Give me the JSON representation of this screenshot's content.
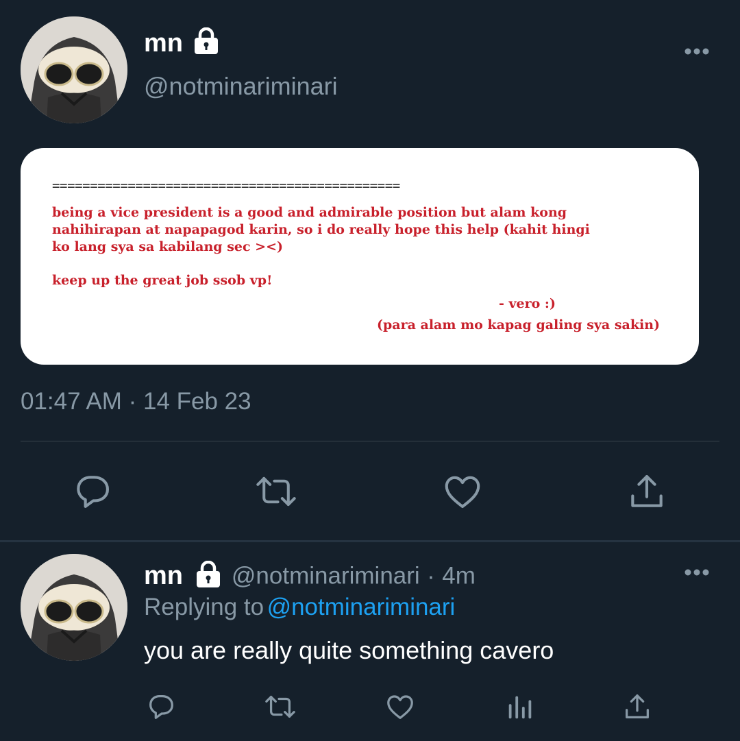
{
  "tweet": {
    "display_name": "mn",
    "handle": "@notminariminari",
    "card": {
      "separator": "==============================================",
      "paragraph1": "being a vice president is a good and admirable position but alam kong\nnahihirapan at napapagod karin, so i do really hope this help (kahit hingi\nko lang sya sa kabilang sec ><)",
      "paragraph2": "keep up the great job ssob vp!",
      "signature": "- vero :)",
      "note": "(para alam mo kapag galing sya sakin)"
    },
    "timestamp": "01:47 AM · 14 Feb 23",
    "actions": [
      "reply-icon",
      "retweet-icon",
      "like-icon",
      "share-icon"
    ]
  },
  "reply": {
    "display_name": "mn",
    "handle": "@notminariminari",
    "separator_dot": "·",
    "time": "4m",
    "replying_prefix": "Replying to",
    "replying_to": "@notminariminari",
    "text": "you are really quite something cavero",
    "actions": [
      "reply-icon",
      "retweet-icon",
      "like-icon",
      "analytics-icon",
      "share-icon"
    ]
  },
  "colors": {
    "background": "#15202b",
    "secondary_text": "#8899a6",
    "link": "#1da1f2",
    "card_text": "#c8202b"
  }
}
